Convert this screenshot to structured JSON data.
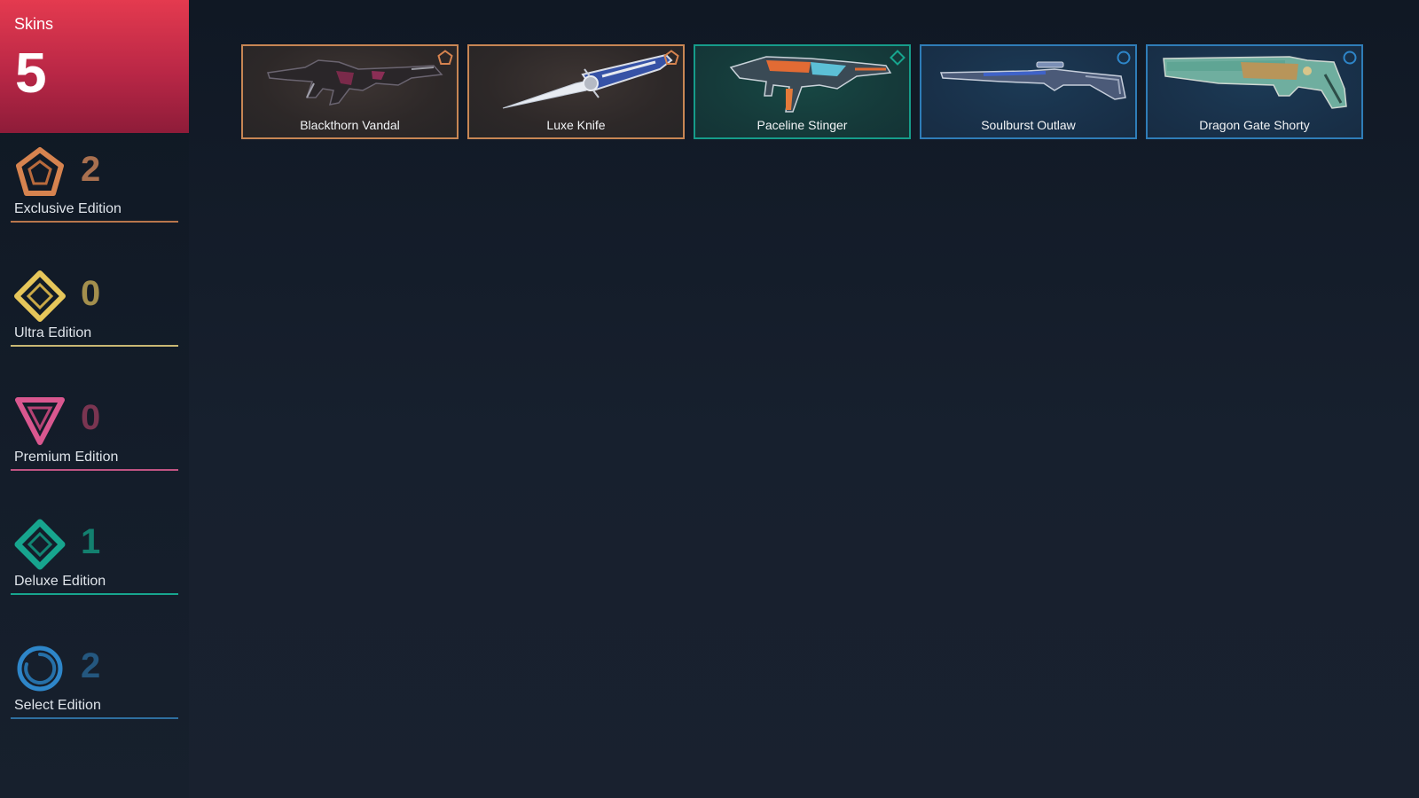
{
  "sidebar": {
    "skins_label": "Skins",
    "skins_count": "5",
    "editions": [
      {
        "name": "Exclusive Edition",
        "count": "2",
        "color": "#d6834f",
        "icon": "exclusive-edition-icon"
      },
      {
        "name": "Ultra Edition",
        "count": "0",
        "color": "#e6c65a",
        "icon": "ultra-edition-icon"
      },
      {
        "name": "Premium Edition",
        "count": "0",
        "color": "#d9578f",
        "icon": "premium-edition-icon"
      },
      {
        "name": "Deluxe Edition",
        "count": "1",
        "color": "#17a58e",
        "icon": "deluxe-edition-icon"
      },
      {
        "name": "Select Edition",
        "count": "2",
        "color": "#2e86c9",
        "icon": "select-edition-icon"
      }
    ]
  },
  "cards": [
    {
      "name": "Blackthorn Vandal",
      "tier": "exclusive",
      "icon": "rifle-icon"
    },
    {
      "name": "Luxe Knife",
      "tier": "exclusive",
      "icon": "knife-icon"
    },
    {
      "name": "Paceline Stinger",
      "tier": "deluxe",
      "icon": "smg-icon"
    },
    {
      "name": "Soulburst Outlaw",
      "tier": "select",
      "icon": "sniper-rifle-icon"
    },
    {
      "name": "Dragon Gate Shorty",
      "tier": "select",
      "icon": "shotgun-icon"
    }
  ]
}
